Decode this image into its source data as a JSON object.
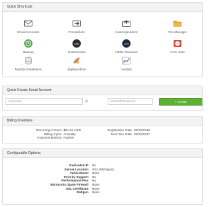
{
  "shortcuts": {
    "title": "Quick Shortcuts",
    "items": [
      {
        "label": "Email Accounts",
        "icon": "email-accounts-icon"
      },
      {
        "label": "Forwarders",
        "icon": "forwarders-icon"
      },
      {
        "label": "Autoresponders",
        "icon": "autoresponders-icon"
      },
      {
        "label": "File Manager",
        "icon": "file-manager-icon"
      },
      {
        "label": "Backup",
        "icon": "backup-icon"
      },
      {
        "label": "Subdomains",
        "icon": "subdomains-icon"
      },
      {
        "label": "Addon Domains",
        "icon": "addon-domains-icon"
      },
      {
        "label": "Cron Jobs",
        "icon": "cron-jobs-icon"
      },
      {
        "label": "MySQL Databases",
        "icon": "mysql-databases-icon"
      },
      {
        "label": "phpMyAdmin",
        "icon": "phpmyadmin-icon"
      },
      {
        "label": "Awstats",
        "icon": "awstats-icon"
      }
    ]
  },
  "email": {
    "title": "Quick Create Email Account",
    "username_placeholder": "Yourname",
    "at_domain": "@",
    "password_placeholder": "Desired Password",
    "create_label": "+ Create"
  },
  "billing": {
    "title": "Billing Overview",
    "left": [
      {
        "label": "Recurring Amount",
        "value": "$64.62 USD"
      },
      {
        "label": "Billing Cycle",
        "value": "Annually"
      },
      {
        "label": "Payment Method",
        "value": "PayPal"
      }
    ],
    "right": [
      {
        "label": "Registration Date",
        "value": "02/22/2016"
      },
      {
        "label": "Next Due Date",
        "value": "02/22/2017"
      }
    ]
  },
  "config": {
    "title": "Configurable Options",
    "options": [
      {
        "label": "Dedicated IP",
        "value": "No"
      },
      {
        "label": "Server Location",
        "value": "USA (Michigan)"
      },
      {
        "label": "Turbo Boost",
        "value": "None"
      },
      {
        "label": "Priority Support",
        "value": "No"
      },
      {
        "label": "Performance Plus",
        "value": "No"
      },
      {
        "label": "Barracuda Spam Firewall",
        "value": "None"
      },
      {
        "label": "SSL Certificate",
        "value": "None"
      },
      {
        "label": "Ratlgun",
        "value": "None"
      }
    ]
  },
  "colors": {
    "create_button": "#5cb130",
    "panel_header": "#f3f3f3",
    "border": "#dcdcdc"
  }
}
